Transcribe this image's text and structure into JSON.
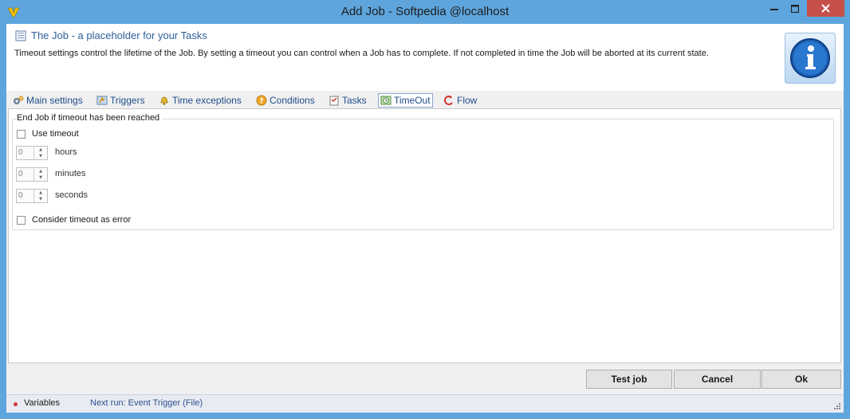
{
  "window": {
    "title": "Add Job - Softpedia @localhost"
  },
  "header": {
    "title": "The Job - a placeholder for your Tasks",
    "description": "Timeout settings control the lifetime of the Job. By setting a timeout you can control when a Job has to complete. If not completed in time the Job will be aborted at its current state."
  },
  "tabs": [
    {
      "label": "Main settings",
      "icon": "gears-icon"
    },
    {
      "label": "Triggers",
      "icon": "trigger-icon"
    },
    {
      "label": "Time exceptions",
      "icon": "bell-icon"
    },
    {
      "label": "Conditions",
      "icon": "question-icon"
    },
    {
      "label": "Tasks",
      "icon": "tasks-icon"
    },
    {
      "label": "TimeOut",
      "icon": "timeout-icon",
      "active": true
    },
    {
      "label": "Flow",
      "icon": "flow-icon"
    }
  ],
  "timeout": {
    "group_label": "End Job if timeout has been reached",
    "use_timeout_label": "Use timeout",
    "use_timeout_checked": false,
    "hours_value": "0",
    "hours_label": "hours",
    "minutes_value": "0",
    "minutes_label": "minutes",
    "seconds_value": "0",
    "seconds_label": "seconds",
    "error_label": "Consider timeout as error",
    "error_checked": false
  },
  "buttons": {
    "test": "Test job",
    "cancel": "Cancel",
    "ok": "Ok"
  },
  "status": {
    "variables": "Variables",
    "next_run": "Next run: Event Trigger (File)"
  },
  "colors": {
    "window_frame": "#5ea5dd",
    "close_button": "#c7514a",
    "tab_text": "#1f4c8a"
  }
}
